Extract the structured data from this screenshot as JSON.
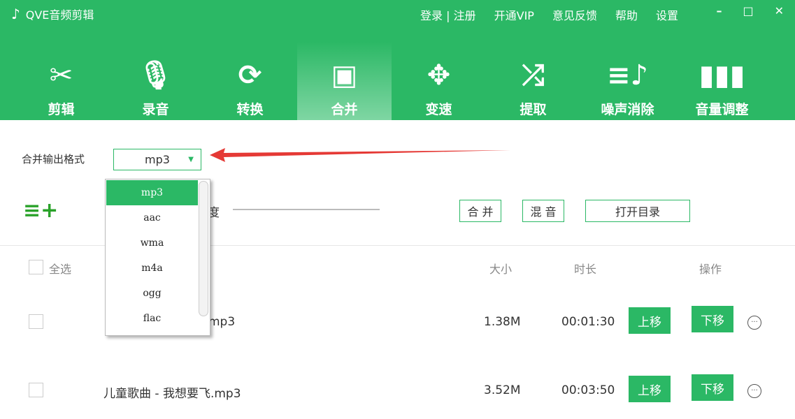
{
  "app": {
    "title": "QVE音频剪辑",
    "links": [
      "登录 | 注册",
      "开通VIP",
      "意见反馈",
      "帮助",
      "设置"
    ]
  },
  "tools": [
    {
      "label": "剪辑",
      "icon": "scissors-icon",
      "glyph": "✂"
    },
    {
      "label": "录音",
      "icon": "microphone-icon",
      "glyph": "🎙"
    },
    {
      "label": "转换",
      "icon": "refresh-icon",
      "glyph": "⟳"
    },
    {
      "label": "合并",
      "icon": "merge-icon",
      "glyph": "▣"
    },
    {
      "label": "变速",
      "icon": "speed-icon",
      "glyph": "✥"
    },
    {
      "label": "提取",
      "icon": "shuffle-icon",
      "glyph": "⤮"
    },
    {
      "label": "噪声消除",
      "icon": "noise-icon",
      "glyph": "≡♪"
    },
    {
      "label": "音量调整",
      "icon": "volume-bars-icon",
      "glyph": "▮▮▮"
    }
  ],
  "format": {
    "label": "合并输出格式",
    "value": "mp3",
    "options": [
      "mp3",
      "aac",
      "wma",
      "m4a",
      "ogg",
      "flac"
    ]
  },
  "toolbar": {
    "progress_label": "进度",
    "merge": "合 并",
    "mix": "混 音",
    "open_dir": "打开目录"
  },
  "table": {
    "select_all": "全选",
    "headers": {
      "size": "大小",
      "duration": "时长",
      "actions": "操作"
    },
    "rows": [
      {
        "name": "mp3",
        "size": "1.38M",
        "duration": "00:01:30"
      },
      {
        "name": "儿童歌曲 - 我想要飞.mp3",
        "size": "3.52M",
        "duration": "00:03:50"
      }
    ],
    "up": "上移",
    "down": "下移",
    "more": "···"
  }
}
